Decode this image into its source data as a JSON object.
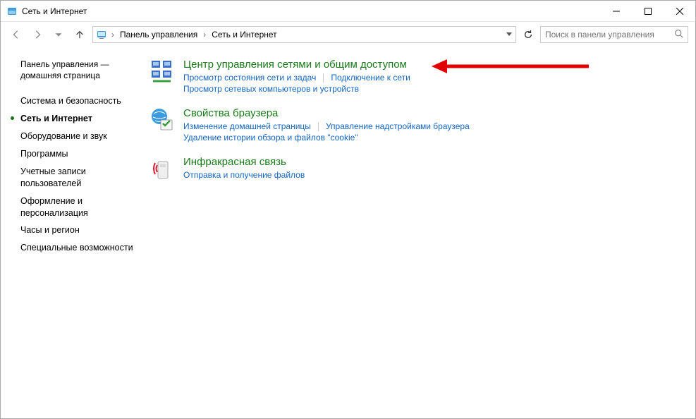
{
  "window": {
    "title": "Сеть и Интернет"
  },
  "breadcrumb": {
    "items": [
      "Панель управления",
      "Сеть и Интернет"
    ]
  },
  "search": {
    "placeholder": "Поиск в панели управления"
  },
  "sidebar": {
    "home": "Панель управления — домашняя страница",
    "items": [
      {
        "label": "Система и безопасность",
        "active": false
      },
      {
        "label": "Сеть и Интернет",
        "active": true
      },
      {
        "label": "Оборудование и звук",
        "active": false
      },
      {
        "label": "Программы",
        "active": false
      },
      {
        "label": "Учетные записи пользователей",
        "active": false
      },
      {
        "label": "Оформление и персонализация",
        "active": false
      },
      {
        "label": "Часы и регион",
        "active": false
      },
      {
        "label": "Специальные возможности",
        "active": false
      }
    ]
  },
  "sections": [
    {
      "title": "Центр управления сетями и общим доступом",
      "links": [
        "Просмотр состояния сети и задач",
        "Подключение к сети",
        "Просмотр сетевых компьютеров и устройств"
      ]
    },
    {
      "title": "Свойства браузера",
      "links": [
        "Изменение домашней страницы",
        "Управление надстройками браузера",
        "Удаление истории обзора и файлов \"cookie\""
      ]
    },
    {
      "title": "Инфракрасная связь",
      "links": [
        "Отправка и получение файлов"
      ]
    }
  ]
}
